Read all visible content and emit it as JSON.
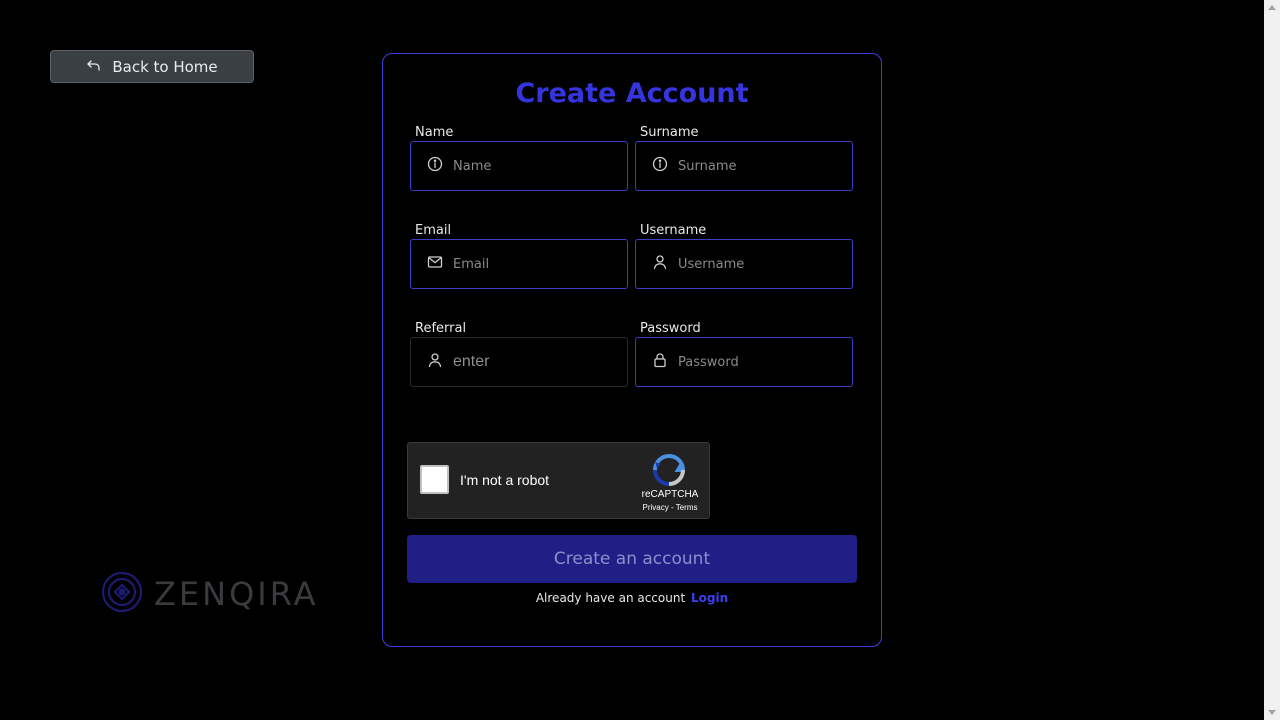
{
  "back_button": {
    "label": "Back to Home",
    "icon": "undo-arrow-icon"
  },
  "logo": {
    "text": "ZENQIRA"
  },
  "form": {
    "title": "Create Account",
    "fields": {
      "name": {
        "label": "Name",
        "placeholder": "Name",
        "icon": "info-icon"
      },
      "surname": {
        "label": "Surname",
        "placeholder": "Surname",
        "icon": "info-icon"
      },
      "email": {
        "label": "Email",
        "placeholder": "Email",
        "icon": "mail-icon"
      },
      "username": {
        "label": "Username",
        "placeholder": "Username",
        "icon": "user-icon"
      },
      "referral": {
        "label": "Referral",
        "placeholder": "enter",
        "icon": "user-icon"
      },
      "password": {
        "label": "Password",
        "placeholder": "Password",
        "icon": "lock-icon"
      }
    },
    "captcha": {
      "label": "I'm not a robot",
      "brand": "reCAPTCHA",
      "links": "Privacy - Terms"
    },
    "submit_label": "Create an account",
    "login_prompt": "Already have an account",
    "login_link": "Login"
  },
  "colors": {
    "accent": "#3535e0",
    "button_bg": "#1f1f86",
    "background": "#000000"
  }
}
